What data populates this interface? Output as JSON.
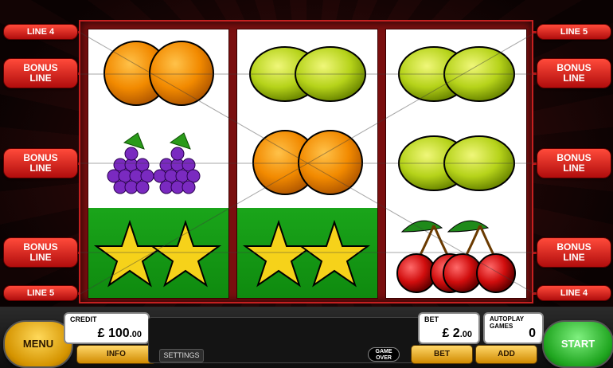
{
  "lines": {
    "left": [
      {
        "lines": [
          "LINE 4"
        ]
      },
      {
        "lines": [
          "BONUS",
          "LINE"
        ]
      },
      {
        "lines": [
          "BONUS",
          "LINE"
        ]
      },
      {
        "lines": [
          "BONUS",
          "LINE"
        ]
      },
      {
        "lines": [
          "LINE 5"
        ]
      }
    ],
    "right": [
      {
        "lines": [
          "LINE 5"
        ]
      },
      {
        "lines": [
          "BONUS",
          "LINE"
        ]
      },
      {
        "lines": [
          "BONUS",
          "LINE"
        ]
      },
      {
        "lines": [
          "BONUS",
          "LINE"
        ]
      },
      {
        "lines": [
          "LINE 4"
        ]
      }
    ]
  },
  "reels": [
    [
      "orange-symbol",
      "grapes-symbol",
      "star-symbol"
    ],
    [
      "lemon-symbol",
      "orange-symbol",
      "star-symbol"
    ],
    [
      "lemon-symbol",
      "lemon-symbol",
      "cherry-symbol"
    ]
  ],
  "controls": {
    "menu_label": "MENU",
    "start_label": "START",
    "info_label": "INFO",
    "settings_label": "SETTINGS",
    "bet_button_label": "BET",
    "add_button_label": "ADD",
    "game_over_1": "GAME",
    "game_over_2": "OVER"
  },
  "credit": {
    "label": "CREDIT",
    "currency": "£",
    "whole": "100",
    "decimals": ".00"
  },
  "bet": {
    "label": "BET",
    "currency": "£",
    "whole": "2",
    "decimals": ".00"
  },
  "autoplay": {
    "label": "AUTOPLAY GAMES",
    "value": "0"
  },
  "colors": {
    "accent_red": "#c21515",
    "gold_button": "#d59400",
    "start_green": "#1fa51f",
    "star_row_green": "#1aa51a"
  }
}
